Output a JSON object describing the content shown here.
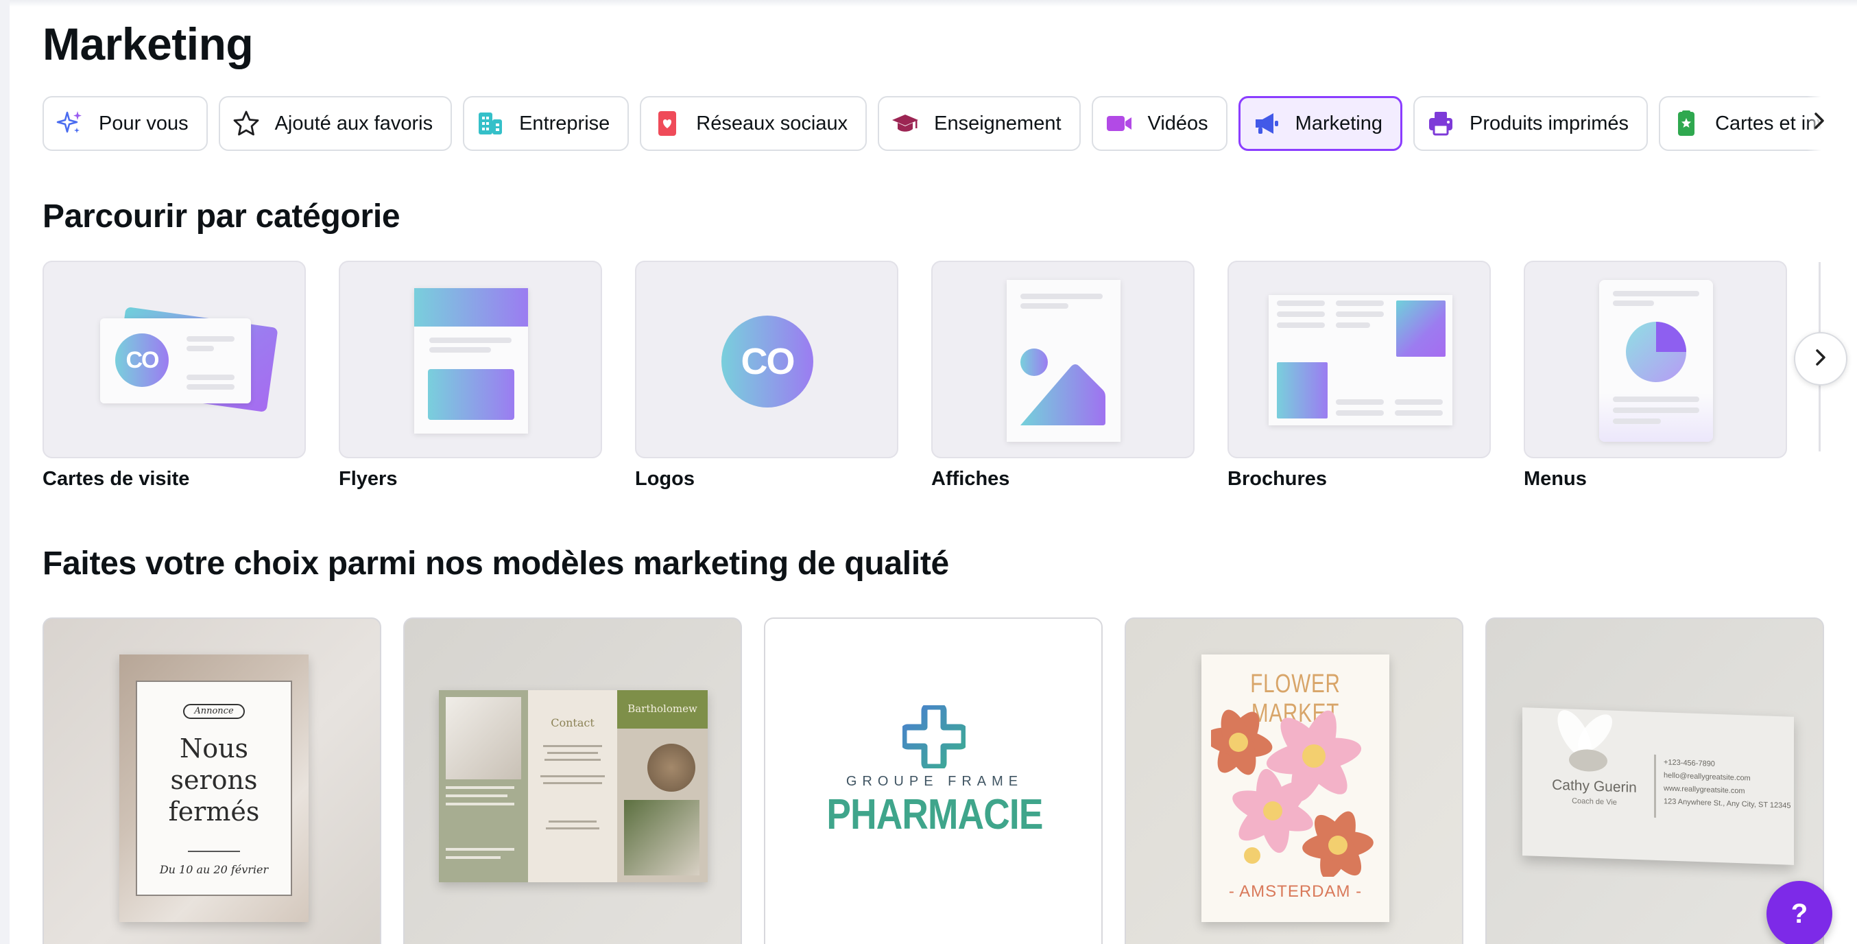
{
  "page": {
    "title": "Marketing"
  },
  "tabs": [
    {
      "label": "Pour vous",
      "icon": "sparkle-icon",
      "active": false
    },
    {
      "label": "Ajouté aux favoris",
      "icon": "star-icon",
      "active": false
    },
    {
      "label": "Entreprise",
      "icon": "building-icon",
      "active": false
    },
    {
      "label": "Réseaux sociaux",
      "icon": "heart-card-icon",
      "active": false
    },
    {
      "label": "Enseignement",
      "icon": "graduation-cap-icon",
      "active": false
    },
    {
      "label": "Vidéos",
      "icon": "video-camera-icon",
      "active": false
    },
    {
      "label": "Marketing",
      "icon": "megaphone-icon",
      "active": true
    },
    {
      "label": "Produits imprimés",
      "icon": "printer-icon",
      "active": false
    },
    {
      "label": "Cartes et invi",
      "icon": "card-icon",
      "active": false
    }
  ],
  "sections": {
    "browse_title": "Parcourir par catégorie",
    "templates_title": "Faites votre choix parmi nos modèles marketing de qualité"
  },
  "categories": [
    {
      "label": "Cartes de visite"
    },
    {
      "label": "Flyers"
    },
    {
      "label": "Logos"
    },
    {
      "label": "Affiches"
    },
    {
      "label": "Brochures"
    },
    {
      "label": "Menus"
    }
  ],
  "logo_glyph": "CO",
  "templates": [
    {
      "kind": "poster",
      "badge": "Annonce",
      "lines": [
        "Nous",
        "serons",
        "fermés"
      ],
      "footer": "Du 10 au 20 février"
    },
    {
      "kind": "brochure",
      "contact_title": "Contact",
      "name": "Bartholomew"
    },
    {
      "kind": "logo",
      "subtitle": "GROUPE FRAME",
      "title": "PHARMACIE"
    },
    {
      "kind": "poster",
      "title": "FLOWER MARKET",
      "footer": "- AMSTERDAM -"
    },
    {
      "kind": "business-card",
      "name": "Cathy Guerin",
      "role": "Coach de Vie",
      "phone": "+123-456-7890",
      "email": "hello@reallygreatsite.com",
      "web": "www.reallygreatsite.com",
      "address": "123 Anywhere St., Any City, ST 12345"
    }
  ],
  "help": {
    "label": "?"
  },
  "colors": {
    "accent": "#8b3dff",
    "help": "#7d2ae8"
  }
}
